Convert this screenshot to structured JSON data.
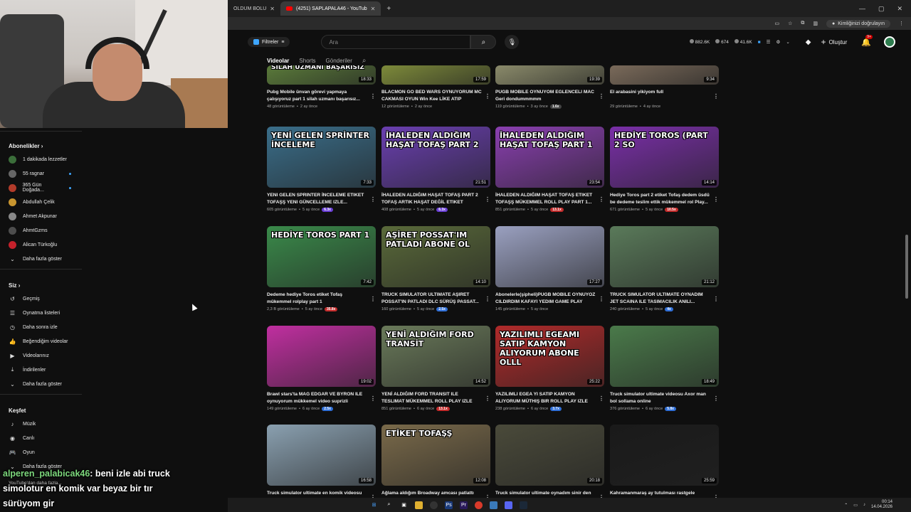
{
  "browser": {
    "tabs": [
      {
        "title": "OLDUM BOLU",
        "active": false
      },
      {
        "title": "(4251) SAPLAPALA46 - YouTub",
        "active": true
      }
    ],
    "profile_label": "Kimliğinizi doğrulayın"
  },
  "header": {
    "filters_label": "Filtreler",
    "search_placeholder": "Ara",
    "stats": [
      "882.6K",
      "674",
      "41.6K"
    ],
    "create_label": "Oluştur",
    "notif_count": "9+"
  },
  "channel_tabs": [
    {
      "label": "Videolar",
      "active": true
    },
    {
      "label": "Shorts",
      "active": false
    },
    {
      "label": "Gönderiler",
      "active": false
    }
  ],
  "sidebar": {
    "subs_title": "Abonelikler",
    "subs": [
      {
        "name": "1 dakikada lezzetler",
        "color": "#3b6e3a",
        "live": false
      },
      {
        "name": "55 ragnar",
        "color": "#666666",
        "live": true
      },
      {
        "name": "365 Gün Doğada...",
        "color": "#b23b2a",
        "live": true
      },
      {
        "name": "Abdullah Çelik",
        "color": "#c8952f",
        "live": false
      },
      {
        "name": "Ahmet Akpunar",
        "color": "#888888",
        "live": false
      },
      {
        "name": "AhmtGzms",
        "color": "#4d4d4d",
        "live": false
      },
      {
        "name": "Alican Türkoğlu",
        "color": "#c4212b",
        "live": false
      }
    ],
    "subs_more": "Daha fazla göster",
    "you_title": "Siz",
    "you_items": [
      {
        "label": "Geçmiş",
        "icon": "↺"
      },
      {
        "label": "Oynatma listeleri",
        "icon": "☰"
      },
      {
        "label": "Daha sonra izle",
        "icon": "◷"
      },
      {
        "label": "Beğendiğim videolar",
        "icon": "👍"
      },
      {
        "label": "Videolarınız",
        "icon": "▶"
      },
      {
        "label": "İndirilenler",
        "icon": "⤓"
      },
      {
        "label": "Daha fazla göster",
        "icon": "⌄"
      }
    ],
    "explore_title": "Keşfet",
    "explore_items": [
      {
        "label": "Müzik",
        "icon": "♪"
      },
      {
        "label": "Canlı",
        "icon": "◉"
      },
      {
        "label": "Oyun",
        "icon": "🎮"
      },
      {
        "label": "Daha fazla göster",
        "icon": "⌄"
      }
    ]
  },
  "chat": {
    "user": "alperen_palabicak46",
    "message_1": ": beni izle abi truck",
    "message_2": "simolotur en komik var beyaz bir tır",
    "message_3": "sürüyom gir",
    "sub_text": "YouTube'dan daha fazla..."
  },
  "videos": [
    {
      "title": "Pubg Mobile ünvan görevi yapmaya çalışıyoruz part 1 silah uzmanı başarısız...",
      "views": "48 görüntüleme",
      "age": "2 ay önce",
      "duration": "18:33",
      "overlay": "SİLAH UZMANI BAŞARISIZ",
      "bg": "#5a7a3a",
      "pill": "",
      "pill_class": ""
    },
    {
      "title": "BLACMON GO BED WARS OYNUYORUM MC CAKMASI OYUN Win Kee LİKE ATIP ABONE...",
      "views": "12 görüntüleme",
      "age": "2 ay önce",
      "duration": "17:59",
      "overlay": "",
      "bg": "#7d8a3a",
      "pill": "",
      "pill_class": ""
    },
    {
      "title": "PUGB MOBILE OYNUYOM EGLENCELI MAC Geri dondummmmm",
      "views": "119 görüntüleme",
      "age": "3 ay önce",
      "duration": "19:39",
      "overlay": "",
      "bg": "#8a8a6a",
      "pill": "1.6x",
      "pill_class": "gray"
    },
    {
      "title": "El arabasini yikiyom full",
      "views": "29 görüntüleme",
      "age": "4 ay önce",
      "duration": "9:34",
      "overlay": "",
      "bg": "#7a6a5a",
      "pill": "",
      "pill_class": ""
    },
    {
      "title": "YENI GELEN SPRINTER İNCELEME ETIKET TOFAŞŞ YENI GÜNCELLEME IZLE...",
      "views": "605 görüntüleme",
      "age": "5 ay önce",
      "duration": "7:33",
      "overlay": "YENİ GELEN SPRİNTER İNCELEME",
      "bg": "#3a6e8a",
      "pill": "6.3x",
      "pill_class": ""
    },
    {
      "title": "İHALEDEN ALDIĞIM HAŞAT TOFAŞ PART 2 TOFAŞ ARTIK HAŞAT DEĞİL ETIKET TOFAŞ...",
      "views": "408 görüntüleme",
      "age": "5 ay önce",
      "duration": "21:51",
      "overlay": "İHALEDEN ALDIĞIM HAŞAT TOFAŞ PART 2",
      "bg": "#6a3fb0",
      "pill": "6.3x",
      "pill_class": ""
    },
    {
      "title": "İHALEDEN ALDIĞIM HAŞAT TOFAŞ ETIKET TOFAŞŞ MÜKEMMEL ROLL PLAY PART 1...",
      "views": "851 görüntüleme",
      "age": "5 ay önce",
      "duration": "23:54",
      "overlay": "İHALEDEN ALDIĞIM HAŞAT TOFAŞ PART 1",
      "bg": "#8a3fb0",
      "pill": "13.1x",
      "pill_class": "red"
    },
    {
      "title": "Hediye Toros part 2 etiket Tofaş dedem üsdü be dedeme teslim ettik mükemmel rol Play...",
      "views": "671 görüntüleme",
      "age": "5 ay önce",
      "duration": "14:14",
      "overlay": "HEDİYE TOROS (PART 2 SO",
      "bg": "#7a2fa8",
      "pill": "10.5x",
      "pill_class": "red"
    },
    {
      "title": "Dedeme hediye Toros etiket Tofaş mükemmel rolplay part 1",
      "views": "2,3 B görüntüleme",
      "age": "5 ay önce",
      "duration": "7:42",
      "overlay": "HEDİYE TOROS PART 1",
      "bg": "#3a8a4a",
      "pill": "35.8x",
      "pill_class": "red"
    },
    {
      "title": "TRUCK SIMULATOR ULTIMATE AŞIRET POSSAT'IN PATLADI DLC SÜRÜŞ PASSAT...",
      "views": "160 görüntüleme",
      "age": "5 ay önce",
      "duration": "14:10",
      "overlay": "AŞİRET POSSAT'IM PATLADI ABONE OL",
      "bg": "#5a6a3a",
      "pill": "2.5x",
      "pill_class": "blue"
    },
    {
      "title": "Abonelerle(şipheli)PUGB MOBILE OYNUYOZ CILDIRDIM KAFAYI YEDIM GAME PLAY",
      "views": "145 görüntüleme",
      "age": "5 ay önce",
      "duration": "17:27",
      "overlay": "",
      "bg": "#9aa0c0",
      "pill": "",
      "pill_class": ""
    },
    {
      "title": "TRUCK SIMULATOR ULTIMATE OYNADIM JET SCAINA ILE TASIMACILIK ANILI...",
      "views": "240 görüntüleme",
      "age": "5 ay önce",
      "duration": "21:12",
      "overlay": "",
      "bg": "#5a7a5a",
      "pill": "4x",
      "pill_class": "blue"
    },
    {
      "title": "Brawl stars'ta MAG EDGAR VE BYRON ILE oynuyorum mükkemel video suprizli",
      "views": "149 görüntüleme",
      "age": "6 ay önce",
      "duration": "19:02",
      "overlay": "",
      "bg": "#c02fa0",
      "pill": "2.5x",
      "pill_class": "blue"
    },
    {
      "title": "YENİ ALDIĞIM FORD TRANSIT ILE TESLIMAT MÜKEMMEL ROLL PLAY IZLE",
      "views": "851 görüntüleme",
      "age": "6 ay önce",
      "duration": "14:52",
      "overlay": "YENİ ALDIĞIM FORD TRANSİT",
      "bg": "#6a7a5a",
      "pill": "13.1x",
      "pill_class": "red"
    },
    {
      "title": "YAZILIMLI EGEA YI SATIP KAMYON ALIYORUM MÜTHIŞ BIR ROLL PLAY IZLE",
      "views": "238 görüntüleme",
      "age": "6 ay önce",
      "duration": "25:22",
      "overlay": "YAZILIMLI EGEAMI SATIP KAMYON ALIYORUM ABONE OLLL",
      "bg": "#b02a2a",
      "pill": "3.7x",
      "pill_class": "blue"
    },
    {
      "title": "Truck simulator ultimate videosu Axor man bol sollama online",
      "views": "376 görüntüleme",
      "age": "6 ay önce",
      "duration": "18:49",
      "overlay": "",
      "bg": "#4a7a4a",
      "pill": "5.8x",
      "pill_class": "blue"
    },
    {
      "title": "Truck simulator ultimate en komik videosu",
      "views": "",
      "age": "",
      "duration": "16:58",
      "overlay": "",
      "bg": "#8aa0b0",
      "pill": "",
      "pill_class": ""
    },
    {
      "title": "Ağlama aldığım Broadway amcası patlattı",
      "views": "",
      "age": "",
      "duration": "12:08",
      "overlay": "ETİKET TOFAŞŞ",
      "bg": "#7a6a4a",
      "pill": "",
      "pill_class": ""
    },
    {
      "title": "Truck simulator ultimate oynadım sinir den",
      "views": "",
      "age": "",
      "duration": "20:18",
      "overlay": "",
      "bg": "#4a4a3a",
      "pill": "",
      "pill_class": ""
    },
    {
      "title": "Kahramanmaraş ay tutulması rastgele",
      "views": "",
      "age": "",
      "duration": "25:59",
      "overlay": "",
      "bg": "#1a1a1a",
      "pill": "",
      "pill_class": ""
    }
  ],
  "taskbar": {
    "time": "00:14",
    "date": "14.04.2026"
  }
}
